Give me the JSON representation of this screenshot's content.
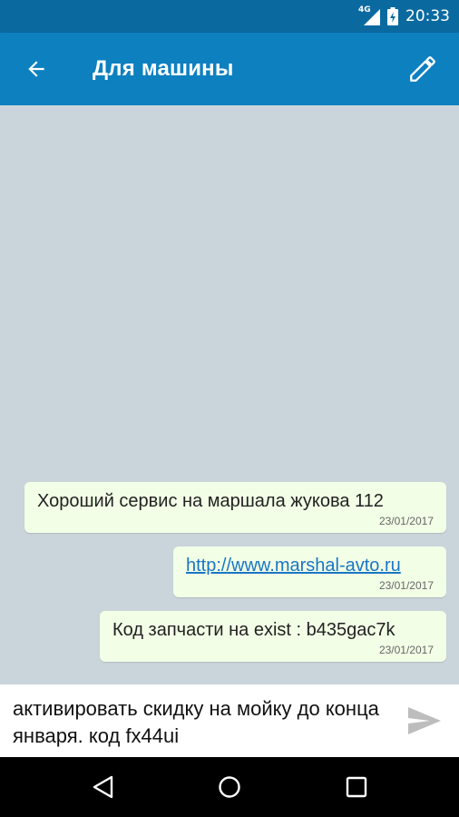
{
  "status_bar": {
    "network": "4G",
    "time": "20:33"
  },
  "app_bar": {
    "title": "Для машины",
    "back_icon": "arrow-left-icon",
    "edit_icon": "pencil-icon"
  },
  "messages": [
    {
      "text": "Хороший сервис на маршала жукова 112",
      "date": "23/01/2017",
      "is_link": false
    },
    {
      "text": "http://www.marshal-avto.ru",
      "date": "23/01/2017",
      "is_link": true
    },
    {
      "text": "Код запчасти на exist : b435gac7k",
      "date": "23/01/2017",
      "is_link": false
    }
  ],
  "composer": {
    "value": "активировать скидку на мойку до конца января. код fx44ui",
    "send_icon": "send-icon"
  },
  "nav_bar": {
    "back_icon": "nav-back-icon",
    "home_icon": "nav-home-icon",
    "recents_icon": "nav-recents-icon"
  },
  "colors": {
    "status_bar": "#0a6aa0",
    "app_bar": "#0d80c0",
    "chat_background": "#c9d5da",
    "bubble": "#f2ffe6",
    "link": "#1976c6"
  }
}
